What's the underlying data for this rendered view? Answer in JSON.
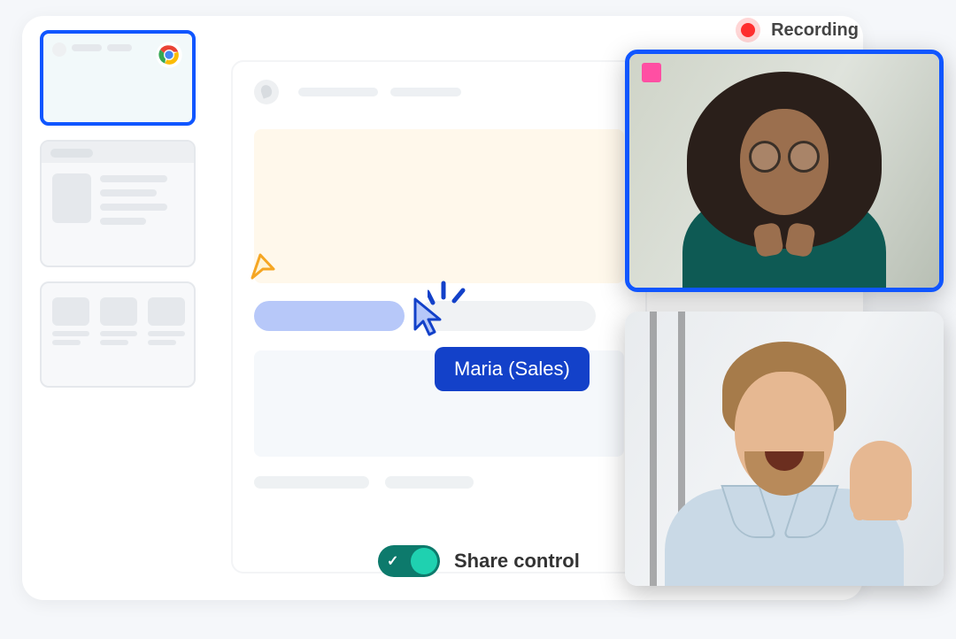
{
  "recording": {
    "label": "Recording"
  },
  "cursor": {
    "participant_label": "Maria (Sales)"
  },
  "share_control": {
    "label": "Share control",
    "enabled": true
  },
  "sidebar": {
    "thumbnails": [
      {
        "id": "browser-tab",
        "active": true,
        "icon": "chrome"
      },
      {
        "id": "document-preview",
        "active": false
      },
      {
        "id": "gallery-preview",
        "active": false
      }
    ]
  },
  "video": {
    "participants": [
      {
        "name": "participant-1",
        "speaking": true
      },
      {
        "name": "participant-2",
        "speaking": false
      }
    ]
  }
}
